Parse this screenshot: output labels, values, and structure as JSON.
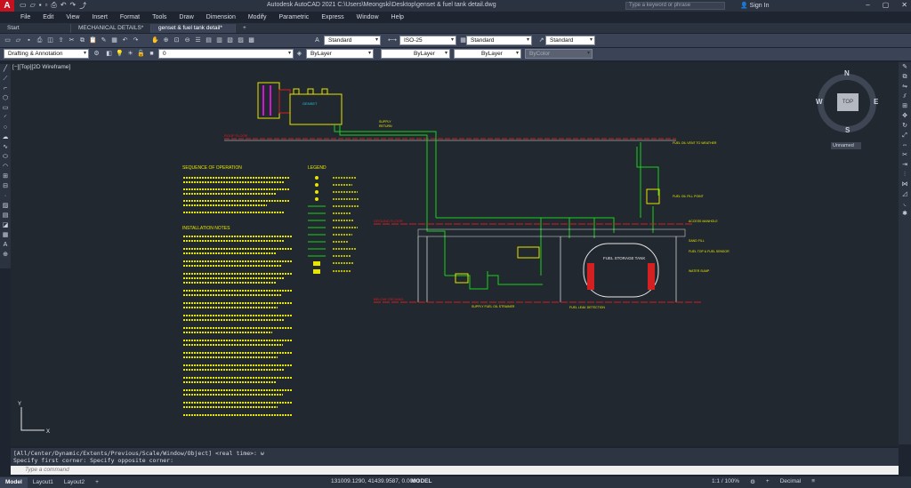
{
  "app": {
    "logo": "A",
    "title": "Autodesk AutoCAD 2021   C:\\Users\\Meongski\\Desktop\\genset & fuel tank detail.dwg",
    "search_placeholder": "Type a keyword or phrase",
    "sign_in": "Sign In"
  },
  "menu": [
    "File",
    "Edit",
    "View",
    "Insert",
    "Format",
    "Tools",
    "Draw",
    "Dimension",
    "Modify",
    "Parametric",
    "Express",
    "Window",
    "Help"
  ],
  "doc_tabs": [
    {
      "label": "Start",
      "active": false
    },
    {
      "label": "MECHANICAL DETAILS*",
      "active": false
    },
    {
      "label": "genset & fuel tank detail*",
      "active": true
    }
  ],
  "toolbar": {
    "text_style": "Standard",
    "dim_style": "ISO-25",
    "table_style": "Standard",
    "multileader_style": "Standard",
    "workspace": "Drafting & Annotation",
    "layer": "0",
    "color": "ByLayer",
    "linetype": "ByLayer",
    "lineweight": "ByLayer",
    "plotstyle": "ByColor"
  },
  "viewport_label": "[−][Top][2D Wireframe]",
  "viewcube": {
    "top": "TOP",
    "n": "N",
    "s": "S",
    "e": "E",
    "w": "W",
    "ucs": "Unnamed"
  },
  "command": {
    "history1": "[All/Center/Dynamic/Extents/Previous/Scale/Window/Object] <real time>: w",
    "history2": "Specify first corner: Specify opposite corner:",
    "placeholder": "Type a command"
  },
  "layouts": [
    {
      "label": "Model",
      "active": true
    },
    {
      "label": "Layout1",
      "active": false
    },
    {
      "label": "Layout2",
      "active": false
    }
  ],
  "status": {
    "coords": "131009.1290, 41439.9587, 0.0000",
    "model": "MODEL",
    "scale": "1:1 / 100%",
    "units": "Decimal"
  },
  "drawing": {
    "seq_title": "SEQUENCE OF OPERATION",
    "legend_title": "LEGEND",
    "install_title": "INSTALLATION NOTES",
    "ground_floor": "GROUND FLOOR",
    "fuel_tank": "FUEL STORAGE TANK",
    "genset_label": "GENSET",
    "ucs_x": "X",
    "ucs_y": "Y"
  },
  "colors": {
    "drawing_green": "#19d219",
    "drawing_yellow": "#e6e600",
    "drawing_red": "#d42020",
    "drawing_white": "#e8e8e8",
    "drawing_magenta": "#d018d0",
    "drawing_cyan": "#22c8e0"
  }
}
